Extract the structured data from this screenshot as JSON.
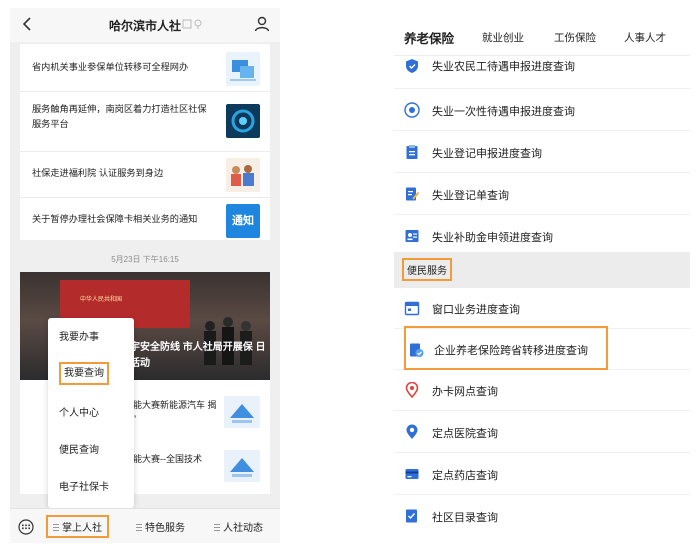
{
  "left": {
    "title": "哈尔滨市人社",
    "news": [
      {
        "text": "省内机关事业参保单位转移可全程网办"
      },
      {
        "text": "服务触角再延伸，南岗区着力打造社区社保服务平台"
      },
      {
        "text": "社保走进福利院 认证服务到身边"
      },
      {
        "text": "关于暂停办理社会保障卡相关业务的通知",
        "thumb_text": "通知"
      }
    ],
    "timestamp": "5月23日 下午16:15",
    "banner": {
      "caption": "宇安全防线 市人社局开展保 日活动",
      "stage_text": "中华人民共和国"
    },
    "lower_news": [
      {
        "text": "技能大赛新能源汽车 揭秘”"
      },
      {
        "text": "技能大赛--全国技术"
      }
    ],
    "popup_menu": [
      "我要办事",
      "我要查询",
      "个人中心",
      "便民查询",
      "电子社保卡"
    ],
    "bottom_tabs": [
      "掌上人社",
      "特色服务",
      "人社动态"
    ]
  },
  "right": {
    "tabs": [
      "养老保险",
      "就业创业",
      "工伤保险",
      "人事人才"
    ],
    "rows_top": [
      {
        "label": "失业农民工待遇申报进度查询",
        "icon": "shield-icon"
      },
      {
        "label": "失业一次性待遇申报进度查询",
        "icon": "target-icon"
      },
      {
        "label": "失业登记申报进度查询",
        "icon": "clipboard-icon"
      },
      {
        "label": "失业登记单查询",
        "icon": "edit-doc-icon"
      },
      {
        "label": "失业补助金申领进度查询",
        "icon": "id-card-icon"
      }
    ],
    "section_title": "便民服务",
    "rows_bottom": [
      {
        "label": "窗口业务进度查询",
        "icon": "calendar-icon"
      },
      {
        "label": "企业养老保险跨省转移进度查询",
        "icon": "doc-check-icon"
      },
      {
        "label": "办卡网点查询",
        "icon": "location-pin-icon"
      },
      {
        "label": "定点医院查询",
        "icon": "hospital-pin-icon"
      },
      {
        "label": "定点药店查询",
        "icon": "card-icon"
      },
      {
        "label": "社区目录查询",
        "icon": "list-check-icon"
      }
    ],
    "colors": {
      "accent": "#f39a3a",
      "icon_blue": "#2f6fd6",
      "pin_red": "#e0433c"
    }
  }
}
